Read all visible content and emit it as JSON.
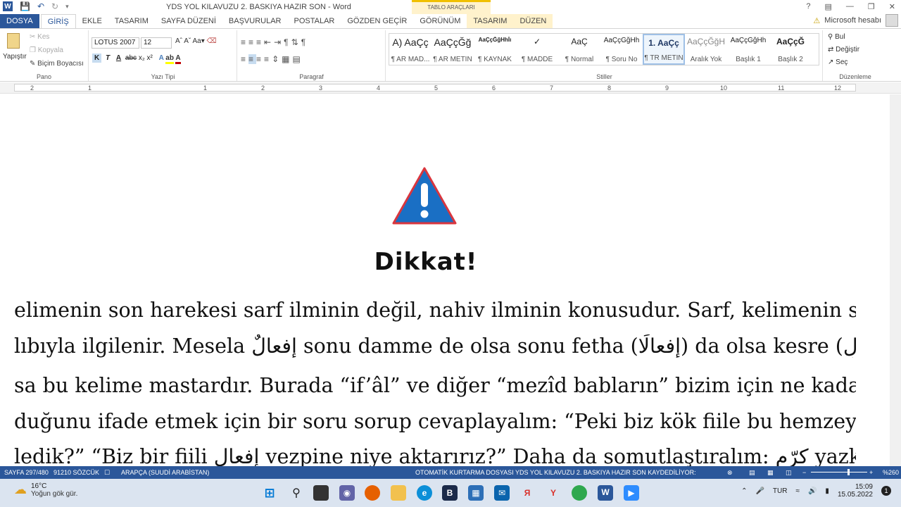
{
  "title": "YDS YOL KILAVUZU 2. BASKIYA HAZIR SON - Word",
  "tool_context": "TABLO ARAÇLARI",
  "tabs": [
    "DOSYA",
    "GİRİŞ",
    "EKLE",
    "TASARIM",
    "SAYFA DÜZENİ",
    "BAŞVURULAR",
    "POSTALAR",
    "GÖZDEN GEÇİR",
    "GÖRÜNÜM",
    "TASARIM",
    "DÜZEN"
  ],
  "account": "Microsoft hesabı",
  "ribbon": {
    "pano": {
      "label": "Pano",
      "paste": "Yapıştır",
      "cut": "Kes",
      "copy": "Kopyala",
      "format_painter": "Biçim Boyacısı"
    },
    "font": {
      "label": "Yazı Tipi",
      "name": "LOTUS 2007",
      "size": "12"
    },
    "paragraph": {
      "label": "Paragraf"
    },
    "styles": {
      "label": "Stiller",
      "items": [
        {
          "preview": "A) AaÇç",
          "name": "¶ AR MAD..."
        },
        {
          "preview": "AaÇçĞğ",
          "name": "¶ AR METİN"
        },
        {
          "preview": "AaÇçĞğHhİı",
          "name": "¶ KAYNAK"
        },
        {
          "preview": "✓",
          "name": "¶ MADDE"
        },
        {
          "preview": "AaÇ",
          "name": "¶ Normal"
        },
        {
          "preview": "AaÇçĞğHh",
          "name": "¶ Soru No"
        },
        {
          "preview": "1. AaÇç",
          "name": "¶ TR METİN"
        },
        {
          "preview": "AaÇçĞğH",
          "name": "Aralık Yok"
        },
        {
          "preview": "AaÇçĞğHh",
          "name": "Başlık 1"
        },
        {
          "preview": "AaÇçĞ",
          "name": "Başlık 2"
        }
      ]
    },
    "editing": {
      "label": "Düzenleme",
      "find": "Bul",
      "replace": "Değiştir",
      "select": "Seç"
    }
  },
  "ruler": [
    "2",
    "1",
    "1",
    "2",
    "3",
    "4",
    "5",
    "6",
    "7",
    "8",
    "9",
    "10",
    "11",
    "12"
  ],
  "document": {
    "heading": "Dikkat!",
    "lines": [
      "elimenin son harekesi sarf ilminin değil, nahiv ilminin konusudur. Sarf, kelimenin sadece",
      "lıbıyla ilgilenir. Mesela إفعالٌ sonu damme de olsa sonu fetha (إفعالًا) da olsa kesre (إفعالٍ) de",
      "sa bu kelime mastardır. Burada “if’âl” ve diğer “mezîd babların” bizim için ne kadar önemli",
      "duğunu ifade etmek için bir soru sorup cevaplayalım: “Peki biz kök fiile bu hemzeyi niye",
      "ledik?” “Biz bir fiili إفعال vezpine niye aktarırız?” Daha da somutlaştıralım: كرّم yazken niye"
    ]
  },
  "status": {
    "page": "SAYFA 297/480",
    "words": "91210 SÖZCÜK",
    "language": "ARAPÇA (SUUDİ ARABİSTAN)",
    "autosave": "OTOMATİK KURTARMA DOSYASI YDS YOL KILAVUZU 2. BASKIYA HAZIR SON KAYDEDİLİYOR:",
    "zoom": "%260"
  },
  "taskbar": {
    "temp": "16°C",
    "weather": "Yoğun gök gür.",
    "lang": "TUR",
    "time": "15:09",
    "date": "15.05.2022",
    "notif": "1"
  }
}
